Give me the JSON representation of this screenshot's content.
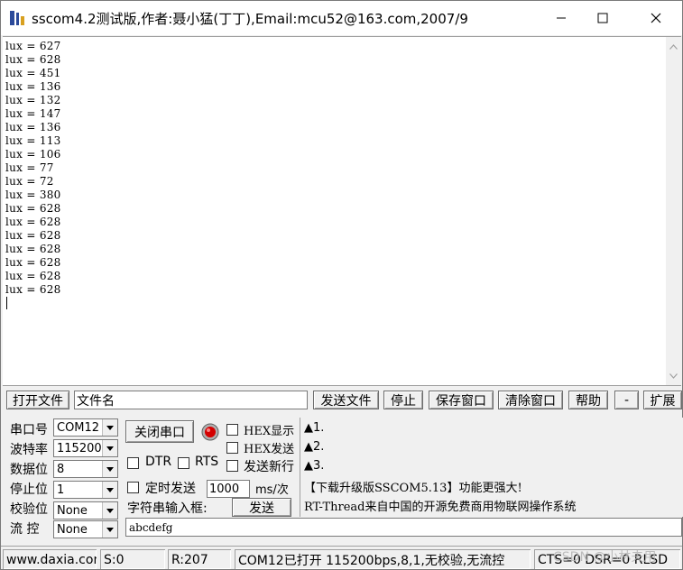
{
  "window": {
    "title": "sscom4.2测试版,作者:聂小猛(丁丁),Email:mcu52@163.com,2007/9"
  },
  "output": {
    "lines": [
      "lux = 627",
      "lux = 628",
      "lux = 451",
      "lux = 136",
      "lux = 132",
      "lux = 147",
      "lux = 136",
      "lux = 113",
      "lux = 106",
      "lux = 77",
      "lux = 72",
      "lux = 380",
      "lux = 628",
      "lux = 628",
      "lux = 628",
      "lux = 628",
      "lux = 628",
      "lux = 628",
      "lux = 628"
    ]
  },
  "toolbar": {
    "open_file": "打开文件",
    "filename": "文件名",
    "send_file": "发送文件",
    "stop": "停止",
    "save_window": "保存窗口",
    "clear_window": "清除窗口",
    "help": "帮助",
    "minus": "-",
    "expand": "扩展"
  },
  "settings": {
    "port_label": "串口号",
    "port_value": "COM12",
    "baud_label": "波特率",
    "baud_value": "115200",
    "databits_label": "数据位",
    "databits_value": "8",
    "stopbits_label": "停止位",
    "stopbits_value": "1",
    "parity_label": "校验位",
    "parity_value": "None",
    "flow_label": "流 控",
    "flow_value": "None",
    "close_port_button": "关闭串口",
    "hex_display": "HEX显示",
    "hex_send": "HEX发送",
    "dtr": "DTR",
    "rts": "RTS",
    "send_newline": "发送新行",
    "timed_send": "定时发送",
    "interval_value": "1000",
    "interval_unit": "ms/次",
    "string_input_label": "字符串输入框:",
    "send_button": "发送",
    "send_text": "abcdefg"
  },
  "info": {
    "line1": "▲1.",
    "line2": "▲2.",
    "line3": "▲3.",
    "upgrade_notice": "【下载升级版SSCOM5.13】功能更强大!",
    "rtthread_notice": "RT-Thread来自中国的开源免费商用物联网操作系统"
  },
  "status": {
    "website": "www.daxia.com",
    "sent": "S:0",
    "received": "R:207",
    "port_status": "COM12已打开  115200bps,8,1,无校验,无流控",
    "lines_status": "CTS=0 DSR=0 RLSD"
  },
  "watermark": "CSDN @小林夫用",
  "colors": {
    "indicator_red": "#d40000",
    "window_bg": "#f0f0f0"
  }
}
